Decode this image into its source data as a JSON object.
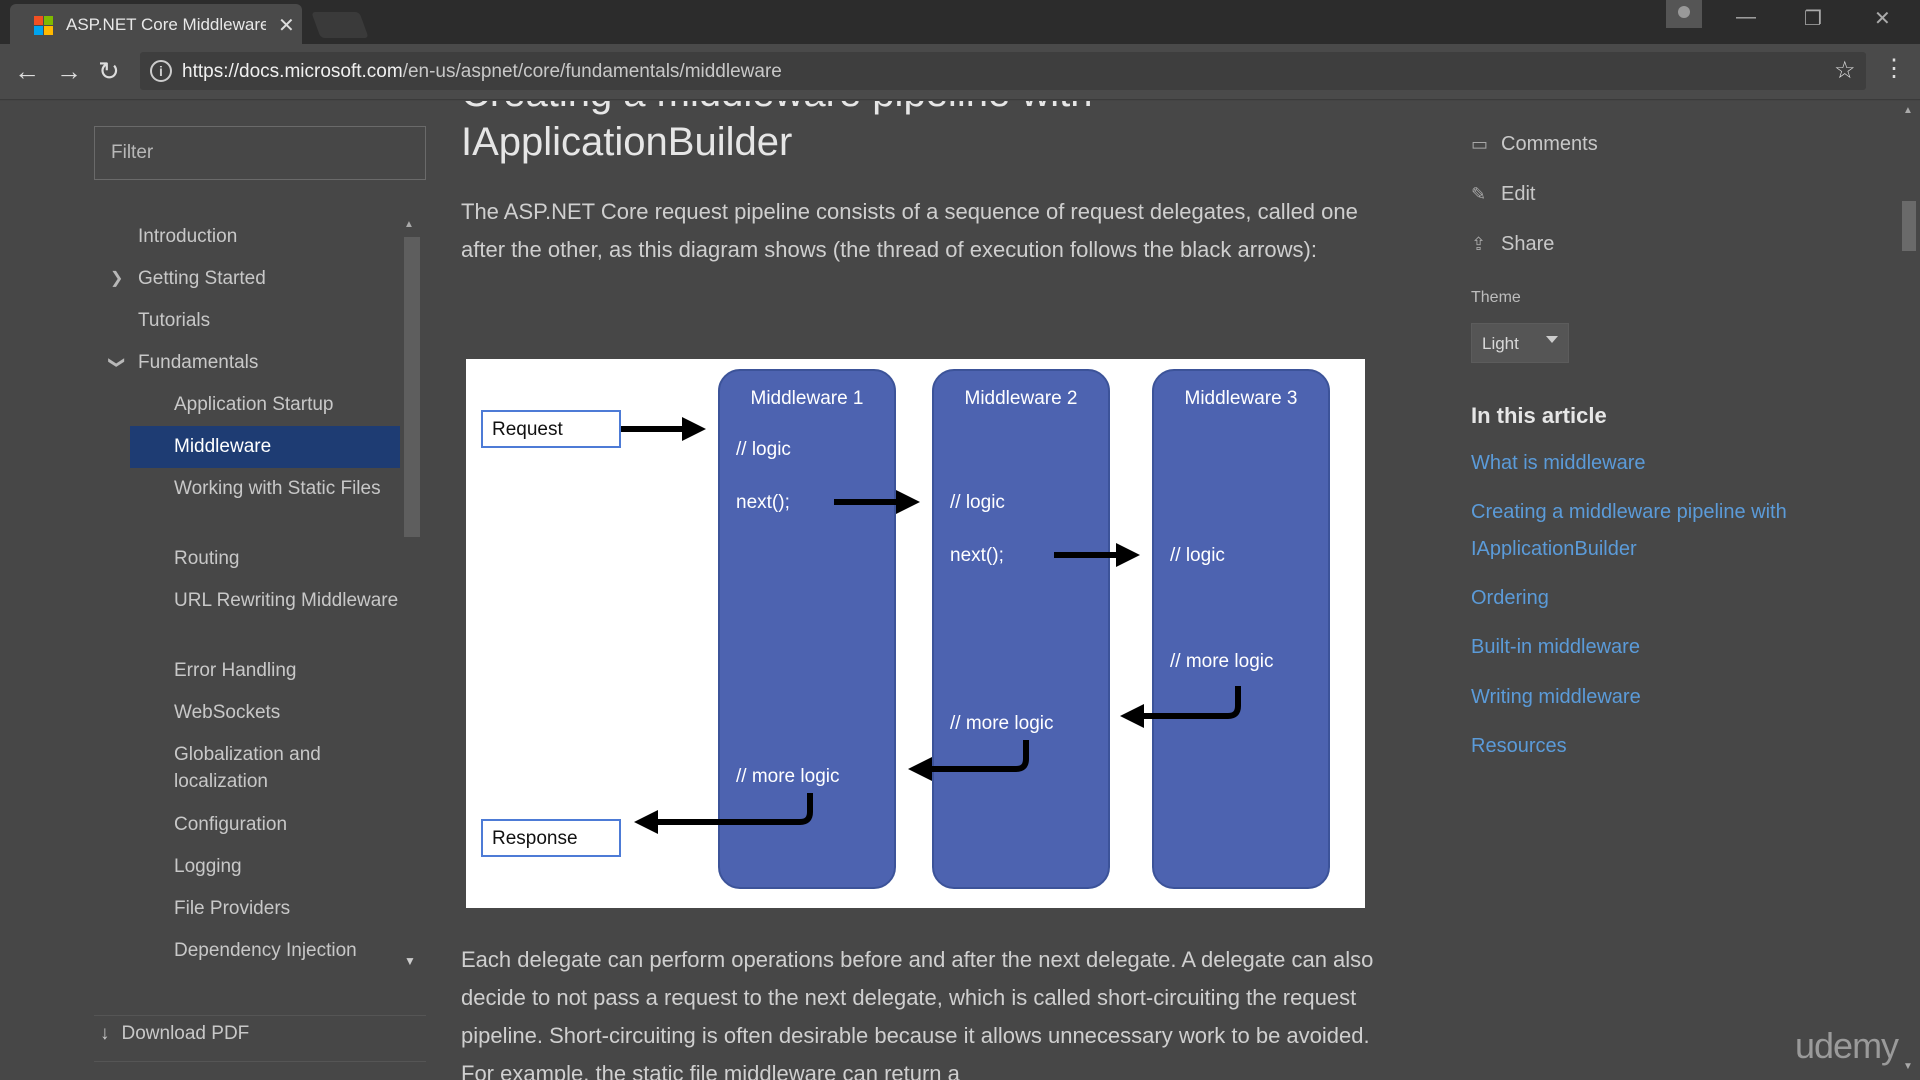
{
  "tab": {
    "title": "ASP.NET Core Middleware"
  },
  "address_bar": {
    "url_host": "https://docs.microsoft.com",
    "url_path": "/en-us/aspnet/core/fundamentals/middleware"
  },
  "sidebar": {
    "filter_placeholder": "Filter",
    "items": [
      {
        "label": "Introduction"
      },
      {
        "label": "Getting Started"
      },
      {
        "label": "Tutorials"
      },
      {
        "label": "Fundamentals"
      },
      {
        "label": "Application Startup"
      },
      {
        "label": "Middleware"
      },
      {
        "label": "Working with Static Files"
      },
      {
        "label": "Routing"
      },
      {
        "label": "URL Rewriting Middleware"
      },
      {
        "label": "Error Handling"
      },
      {
        "label": "WebSockets"
      },
      {
        "label": "Globalization and localization"
      },
      {
        "label": "Configuration"
      },
      {
        "label": "Logging"
      },
      {
        "label": "File Providers"
      },
      {
        "label": "Dependency Injection"
      }
    ],
    "download_pdf": "Download PDF"
  },
  "article": {
    "heading_clipped": "Creating a middleware pipeline with",
    "heading": "IApplicationBuilder",
    "para1": "The ASP.NET Core request pipeline consists of a sequence of request delegates, called one after the other, as this diagram shows (the thread of execution follows the black arrows):",
    "para2": "Each delegate can perform operations before and after the next delegate. A delegate can also decide to not pass a request to the next delegate, which is called short-circuiting the request pipeline. Short-circuiting is often desirable because it allows unnecessary work to be avoided. For example, the static file middleware can return a"
  },
  "diagram": {
    "request": "Request",
    "response": "Response",
    "middleware": [
      {
        "title": "Middleware 1",
        "logic": "// logic",
        "next": "next();",
        "more": "// more logic"
      },
      {
        "title": "Middleware 2",
        "logic": "// logic",
        "next": "next();",
        "more": "// more logic"
      },
      {
        "title": "Middleware 3",
        "logic": "// logic",
        "more": "// more logic"
      }
    ]
  },
  "right": {
    "comments": "Comments",
    "edit": "Edit",
    "share": "Share",
    "theme_label": "Theme",
    "theme_value": "Light",
    "in_this_article": "In this article",
    "links": [
      "What is middleware",
      "Creating a middleware pipeline with IApplicationBuilder",
      "Ordering",
      "Built-in middleware",
      "Writing middleware",
      "Resources"
    ]
  },
  "watermark": "udemy"
}
